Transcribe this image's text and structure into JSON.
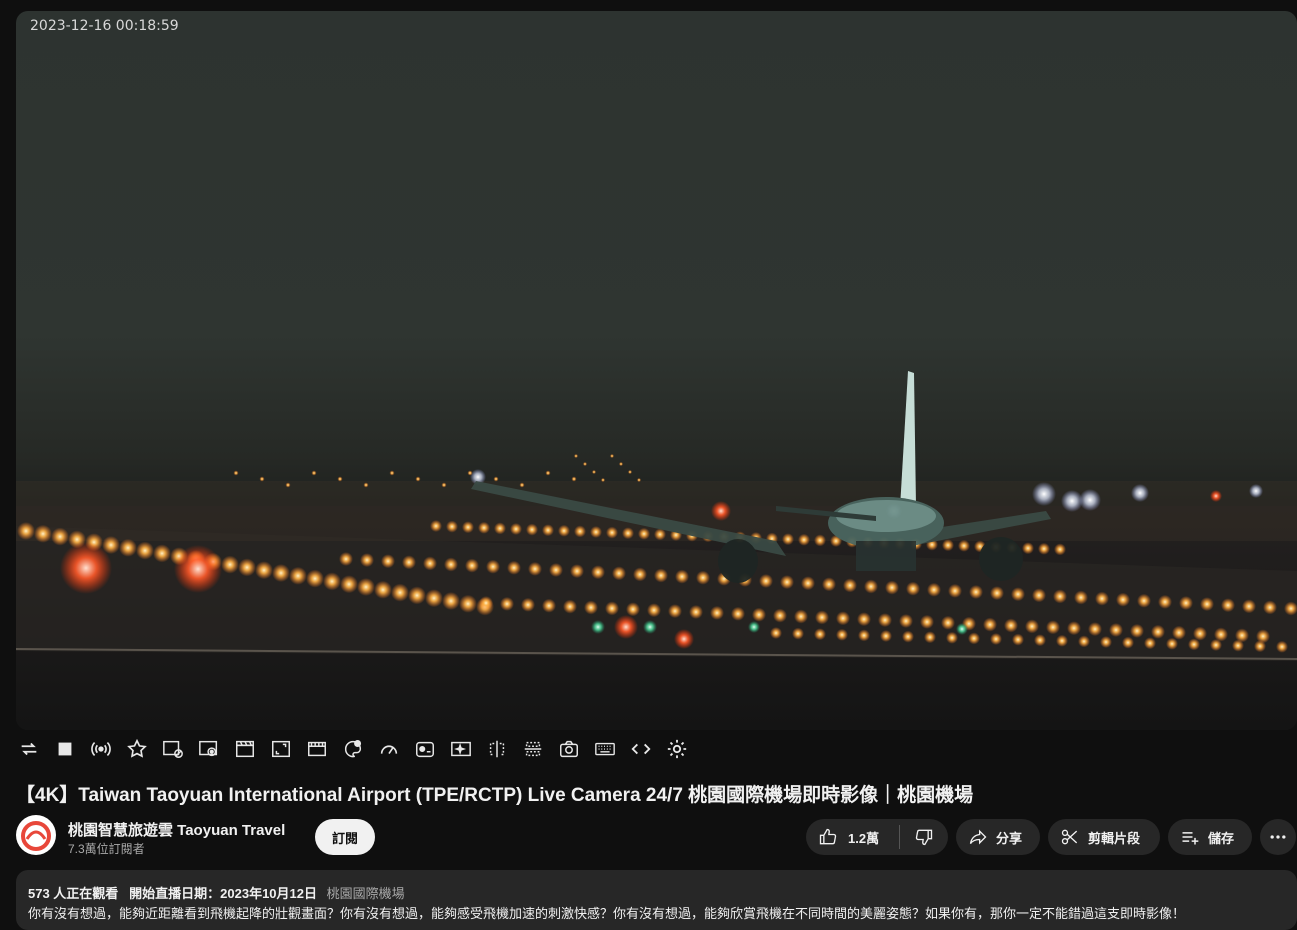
{
  "player": {
    "timestamp": "2023-12-16 00:18:59"
  },
  "controls": [
    {
      "name": "loop-icon"
    },
    {
      "name": "stop-icon"
    },
    {
      "name": "live-broadcast-icon"
    },
    {
      "name": "star-icon"
    },
    {
      "name": "ads-block-icon"
    },
    {
      "name": "cinema-mode-icon"
    },
    {
      "name": "clapperboard-icon"
    },
    {
      "name": "screen-frame-icon"
    },
    {
      "name": "film-strip-icon"
    },
    {
      "name": "color-filter-icon"
    },
    {
      "name": "speed-gauge-icon"
    },
    {
      "name": "color-adjust-icon"
    },
    {
      "name": "sparkle-screen-icon"
    },
    {
      "name": "mirror-icon"
    },
    {
      "name": "split-horizontal-icon"
    },
    {
      "name": "screenshot-camera-icon"
    },
    {
      "name": "keyboard-icon"
    },
    {
      "name": "code-icon"
    },
    {
      "name": "settings-gear-icon"
    }
  ],
  "video": {
    "title": "【4K】Taiwan Taoyuan International Airport (TPE/RCTP) Live Camera 24/7 桃園國際機場即時影像｜桃園機場"
  },
  "channel": {
    "name": "桃園智慧旅遊雲 Taoyuan Travel",
    "subscribers": "7.3萬位訂閱者",
    "subscribe_label": "訂閱"
  },
  "actions": {
    "like_count": "1.2萬",
    "share_label": "分享",
    "clip_label": "剪輯片段",
    "save_label": "儲存"
  },
  "description": {
    "watching": "573 人正在觀看",
    "started": "開始直播日期：2023年10月12日",
    "tag": "桃園國際機場",
    "text": "你有沒有想過，能夠近距離看到飛機起降的壯觀畫面？你有沒有想過，能夠感受飛機加速的刺激快感？你有沒有想過，能夠欣賞飛機在不同時間的美麗姿態？如果你有，那你一定不能錯過這支即時影像！"
  },
  "colors": {
    "background": "#0f0f0f",
    "pill": "#272727",
    "subscribe_bg": "#f1f1f1",
    "runway_light": "#ffb347",
    "avatar_accent": "#e8473a"
  }
}
